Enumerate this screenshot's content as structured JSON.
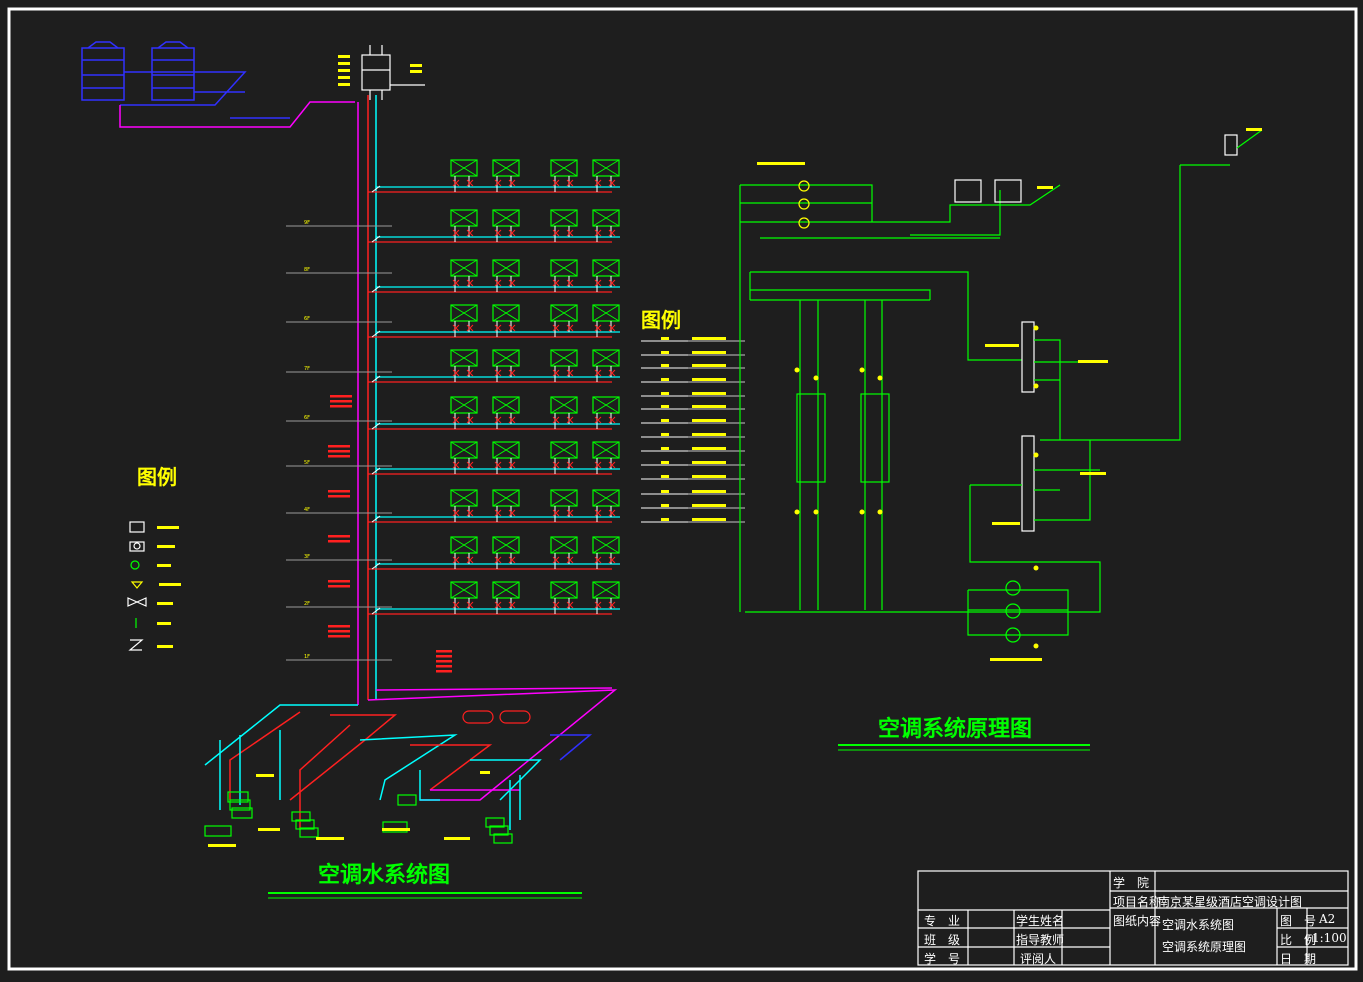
{
  "drawing": {
    "title_water": "空调水系统图",
    "title_principle": "空调系统原理图",
    "legend_left_title": "图例",
    "legend_right_title": "图例"
  },
  "floor_labels": [
    "9F",
    "8F",
    "6F",
    "7F",
    "6F",
    "5F",
    "4F",
    "3F",
    "2F",
    "1F"
  ],
  "title_block": {
    "school_label": "学　院",
    "project_label": "项目名称",
    "project_value": "南京某星级酒店空调设计图",
    "content_label": "图纸内容",
    "content_value_1": "空调水系统图",
    "content_value_2": "空调系统原理图",
    "major_label": "专　业",
    "class_label": "班　级",
    "id_label": "学　号",
    "student_label": "学生姓名",
    "advisor_label": "指导教师",
    "reviewer_label": "评阅人",
    "drawing_no_label": "图　号",
    "drawing_no_value": "A2",
    "scale_label": "比　例",
    "scale_value": "1:100",
    "date_label": "日　期"
  },
  "colors": {
    "background": "#1e1e1e",
    "frame": "#ffffff",
    "title_green": "#00ff00",
    "supply_red": "#ff2020",
    "return_cyan": "#00ffff",
    "magenta": "#ff00ff",
    "blue": "#3030ff",
    "yellow": "#ffff00",
    "green": "#00ff00"
  }
}
